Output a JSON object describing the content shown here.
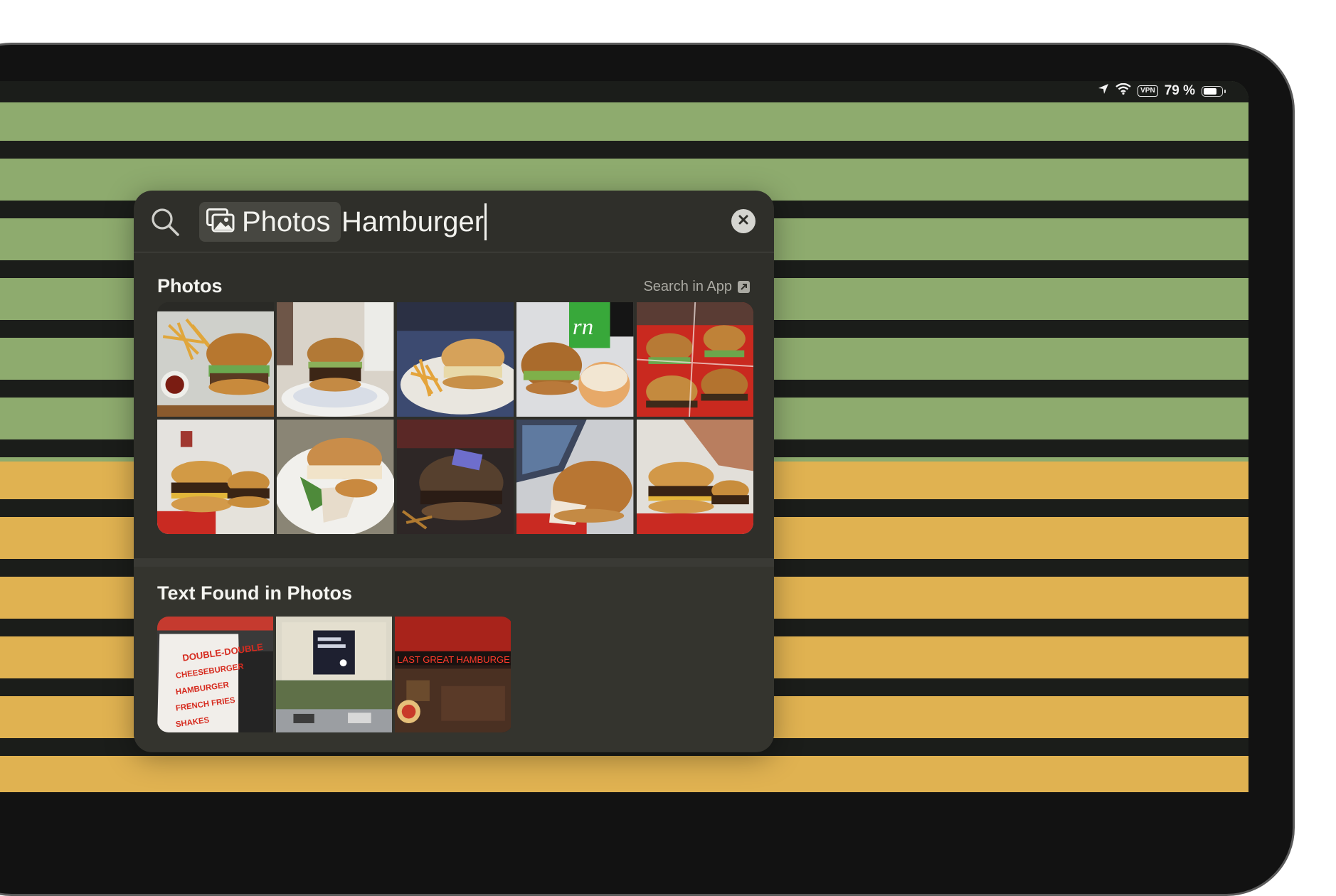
{
  "status_bar": {
    "battery_text": "79 %",
    "battery_level": 0.79,
    "vpn_label": "VPN",
    "icons": [
      "location-arrow-icon",
      "wifi-icon",
      "vpn-badge",
      "battery-icon"
    ]
  },
  "search": {
    "scope_token_label": "Photos",
    "scope_token_icon": "photos-app-icon",
    "query": "Hamburger",
    "search_icon": "magnifier-icon",
    "clear_icon": "clear-x-icon"
  },
  "photos_section": {
    "title": "Photos",
    "search_in_app_label": "Search in App",
    "search_in_app_icon": "open-external-icon",
    "results": [
      {
        "name": "burger-fries-tray"
      },
      {
        "name": "burger-plate-kitchen"
      },
      {
        "name": "burger-fries-plate"
      },
      {
        "name": "burger-wrap-drink"
      },
      {
        "name": "burgers-red-baskets"
      },
      {
        "name": "double-burger-tray"
      },
      {
        "name": "burger-plate-salad"
      },
      {
        "name": "burger-flag-dark"
      },
      {
        "name": "burger-laptop"
      },
      {
        "name": "burger-hand-tray"
      }
    ]
  },
  "text_section": {
    "title": "Text Found in Photos",
    "results": [
      {
        "name": "menu-sign-double-double"
      },
      {
        "name": "street-billboard"
      },
      {
        "name": "neon-sign-restaurant"
      }
    ]
  },
  "colors": {
    "panel_bg": "#2f2f2a",
    "wallpaper_green": "#8eab6e",
    "wallpaper_yellow": "#e0b251",
    "wallpaper_stripe": "#1b1d1a"
  }
}
